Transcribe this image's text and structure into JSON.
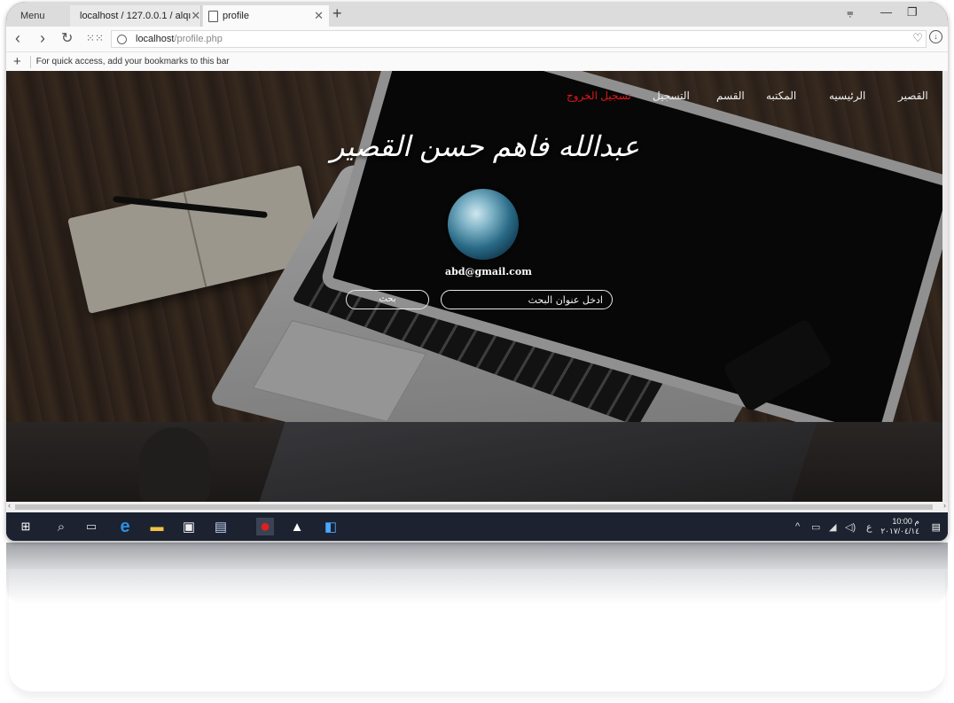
{
  "browser": {
    "menu_label": "Menu",
    "tabs": [
      {
        "title": "localhost / 127.0.0.1 / alqı",
        "icon": "phpmyadmin-icon"
      },
      {
        "title": "profile",
        "icon": "document-icon"
      }
    ],
    "new_tab_symbol": "+",
    "url_host": "localhost",
    "url_path": "/profile.php",
    "bookmarks_hint": "For quick access, add your bookmarks to this bar"
  },
  "site": {
    "nav": [
      "القصير",
      "الرئيسيه",
      "المكتبه",
      "القسم",
      "التسجيل",
      "تسجيل الخروج"
    ],
    "title": "عبدالله فاهم حسن القصير",
    "email": "abd@gmail.com",
    "search_placeholder": "ادخل عنوان البحث",
    "search_button": "بحث"
  },
  "taskbar": {
    "lang": "ع",
    "time": "10:00 م",
    "date": "٢٠١٧/٠٤/١٤"
  },
  "colors": {
    "logout": "#e01818",
    "taskbar": "#1c2230"
  }
}
